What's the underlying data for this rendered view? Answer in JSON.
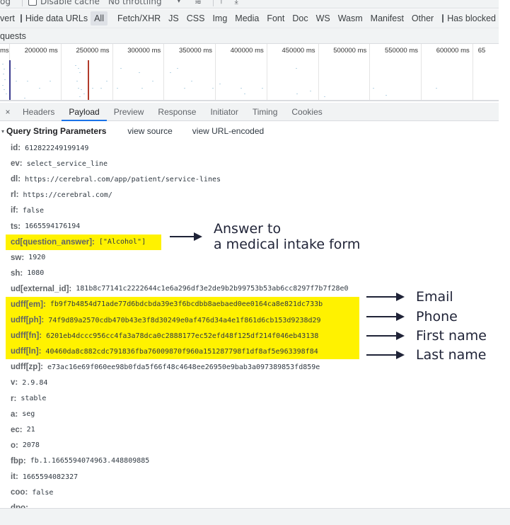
{
  "toolbar": {
    "preserve_log_partial": "og",
    "disable_cache_label": "Disable cache",
    "throttling_value": "No throttling",
    "throttle_caret": "▾",
    "wifi_icon": "≋",
    "upload_icon": "⤒",
    "download_icon": "⤓"
  },
  "filter_bar": {
    "invert_partial": "vert",
    "hide_data_urls_label": "Hide data URLs",
    "filters": [
      "All",
      "Fetch/XHR",
      "JS",
      "CSS",
      "Img",
      "Media",
      "Font",
      "Doc",
      "WS",
      "Wasm",
      "Manifest",
      "Other"
    ],
    "active_filter": "All",
    "has_blocked_cookies_label": "Has blocked cook"
  },
  "blocked_requests_partial": "quests",
  "overview": {
    "tick_labels": [
      "ms",
      "200000 ms",
      "250000 ms",
      "300000 ms",
      "350000 ms",
      "400000 ms",
      "450000 ms",
      "500000 ms",
      "550000 ms",
      "600000 ms",
      "65"
    ],
    "markers": [
      {
        "name": "dom-content-loaded",
        "color": "#3b3b8f"
      },
      {
        "name": "load",
        "color": "#b23b2b"
      }
    ]
  },
  "details": {
    "close_icon": "×",
    "tabs": [
      "Headers",
      "Payload",
      "Preview",
      "Response",
      "Initiator",
      "Timing",
      "Cookies"
    ],
    "active_tab": "Payload"
  },
  "payload": {
    "section_title": "Query String Parameters",
    "view_source": "view source",
    "view_url_encoded": "view URL-encoded",
    "collapse_icon": "▾",
    "params": [
      {
        "key": "id:",
        "value": "612822249199149",
        "highlight": false
      },
      {
        "key": "ev:",
        "value": "select_service_line",
        "highlight": false
      },
      {
        "key": "dl:",
        "value": "https://cerebral.com/app/patient/service-lines",
        "highlight": false
      },
      {
        "key": "rl:",
        "value": "https://cerebral.com/",
        "highlight": false
      },
      {
        "key": "if:",
        "value": "false",
        "highlight": false
      },
      {
        "key": "ts:",
        "value": "1665594176194",
        "highlight": false
      },
      {
        "key": "cd[question_answer]:",
        "value": "[\"Alcohol\"]",
        "highlight": true
      },
      {
        "key": "sw:",
        "value": "1920",
        "highlight": false
      },
      {
        "key": "sh:",
        "value": "1080",
        "highlight": false
      },
      {
        "key": "ud[external_id]:",
        "value": "181b8c77141c2222644c1e6a296df3e2de9b2b99753b53ab6cc8297f7b7f28e0",
        "highlight": false
      },
      {
        "key": "udff[em]:",
        "value": "fb9f7b4854d71ade77d6bdcbda39e3f6bcdbb8aebaed0ee0164ca8e821dc733b",
        "highlight": true
      },
      {
        "key": "udff[ph]:",
        "value": "74f9d89a2570cdb470b43e3f8d30249e0af476d34a4e1f861d6cb153d9238d29",
        "highlight": true
      },
      {
        "key": "udff[fn]:",
        "value": "6201eb4dccc956cc4fa3a78dca0c2888177ec52efd48f125df214f046eb43138",
        "highlight": true
      },
      {
        "key": "udff[ln]:",
        "value": "40460da8c882cdc791836fba76009870f960a151287798f1df8af5e963398f84",
        "highlight": true
      },
      {
        "key": "udff[zp]:",
        "value": "e73ac16e69f060ee98b0fda5f66f48c4648ee26950e9bab3a097389853fd859e",
        "highlight": false
      },
      {
        "key": "v:",
        "value": "2.9.84",
        "highlight": false
      },
      {
        "key": "r:",
        "value": "stable",
        "highlight": false
      },
      {
        "key": "a:",
        "value": "seg",
        "highlight": false
      },
      {
        "key": "ec:",
        "value": "21",
        "highlight": false
      },
      {
        "key": "o:",
        "value": "2078",
        "highlight": false
      },
      {
        "key": "fbp:",
        "value": "fb.1.1665594074963.448809885",
        "highlight": false
      },
      {
        "key": "it:",
        "value": "1665594082327",
        "highlight": false
      },
      {
        "key": "coo:",
        "value": "false",
        "highlight": false
      },
      {
        "key": "dpo:",
        "value": "",
        "highlight": false
      }
    ]
  },
  "annotations": {
    "answer_line1": "Answer to",
    "answer_line2": "a medical intake form",
    "email": "Email",
    "phone": "Phone",
    "first_name": "First name",
    "last_name": "Last name",
    "highlight_color": "#fff200",
    "arrow_color": "#1f2337"
  }
}
